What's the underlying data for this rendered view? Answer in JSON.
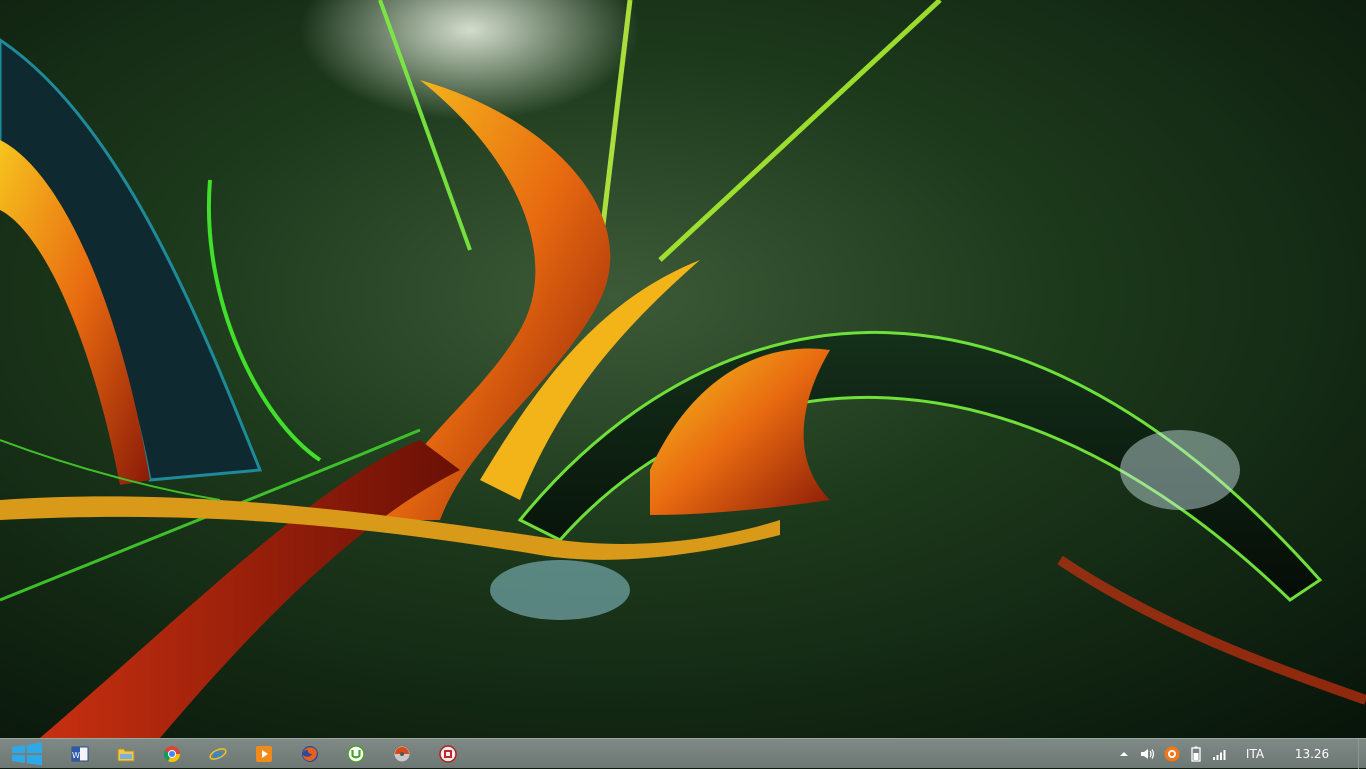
{
  "taskbar": {
    "start_icon": "windows-logo-icon",
    "pinned": [
      {
        "name": "word",
        "icon": "word-icon"
      },
      {
        "name": "file-explorer",
        "icon": "folder-icon"
      },
      {
        "name": "chrome",
        "icon": "chrome-icon"
      },
      {
        "name": "internet-explorer",
        "icon": "ie-icon"
      },
      {
        "name": "media-player",
        "icon": "media-player-icon"
      },
      {
        "name": "firefox",
        "icon": "firefox-icon"
      },
      {
        "name": "utorrent",
        "icon": "utorrent-icon"
      },
      {
        "name": "vlc",
        "icon": "disc-icon"
      },
      {
        "name": "app",
        "icon": "app-icon"
      }
    ],
    "tray": {
      "icons": [
        "chevron-up-icon",
        "speaker-icon",
        "avast-icon",
        "battery-icon",
        "signal-icon"
      ],
      "language": "ITA",
      "time": "13.26"
    },
    "colors": {
      "bar": "#76807c",
      "accent": "#2fa8e8"
    }
  },
  "wallpaper": {
    "colors": [
      "#0c2410",
      "#3fbf2a",
      "#e86a10",
      "#f4c020",
      "#1e8a9a"
    ]
  }
}
